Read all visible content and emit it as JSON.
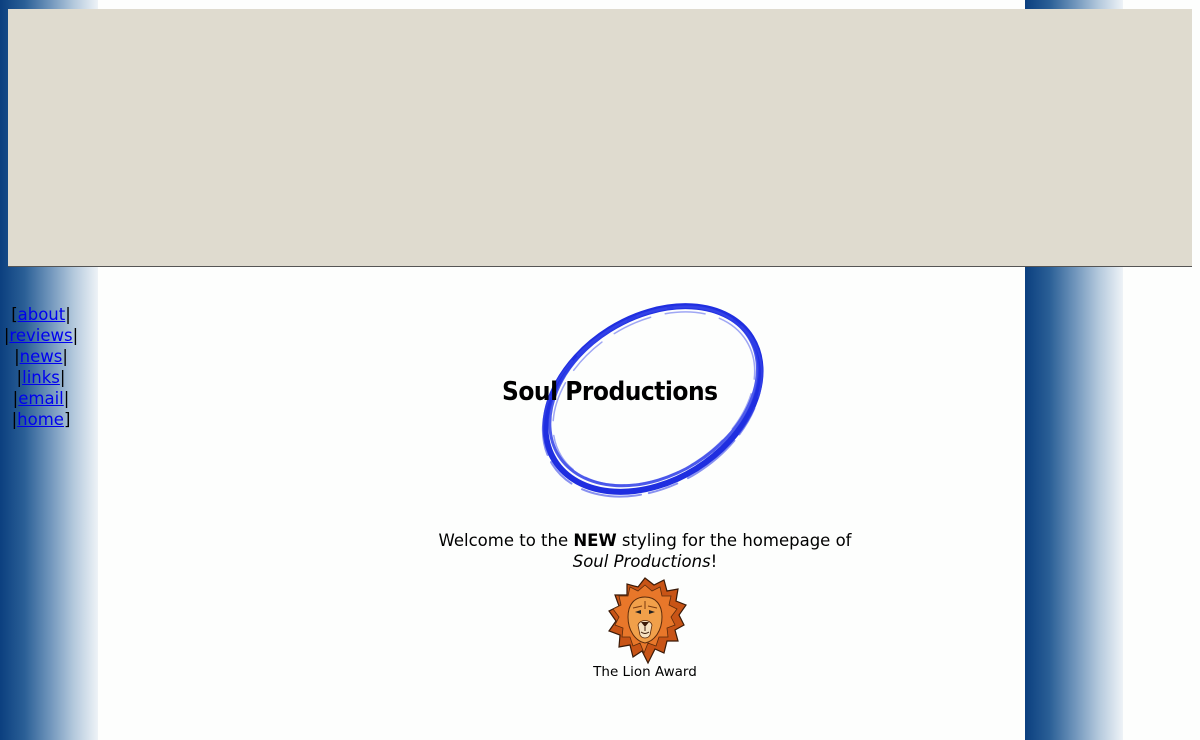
{
  "nav": {
    "items": [
      {
        "label": "about"
      },
      {
        "label": "reviews"
      },
      {
        "label": "news"
      },
      {
        "label": "links"
      },
      {
        "label": "email"
      },
      {
        "label": "home"
      }
    ]
  },
  "logo": {
    "text": "Soul Productions",
    "ring_color": "#1f2ee0"
  },
  "welcome": {
    "prefix": "Welcome to the ",
    "emphasis": "NEW",
    "suffix": " styling for the homepage of",
    "site_name": "Soul Productions",
    "exclaim": "!"
  },
  "award": {
    "caption": "The Lion Award",
    "icon": "lion-icon"
  },
  "colors": {
    "banner_bg": "#dfdbcf",
    "strip_dark": "#0b3f7f",
    "link": "#0000ee"
  }
}
